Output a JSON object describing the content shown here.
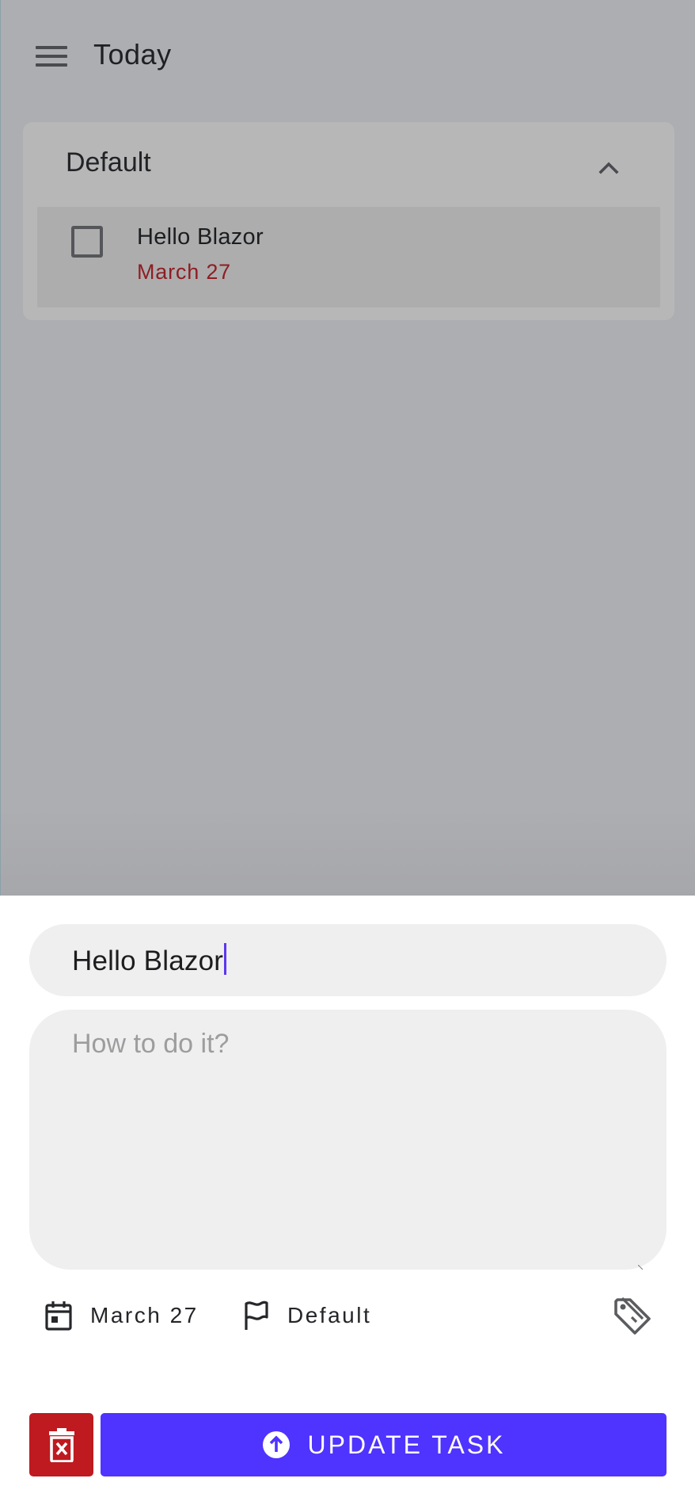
{
  "appbar": {
    "title": "Today",
    "menu_icon": "hamburger-menu-icon"
  },
  "task_group": {
    "title": "Default",
    "toggle_icon": "chevron-up-icon",
    "tasks": [
      {
        "title": "Hello Blazor",
        "due": "March 27",
        "due_color": "#8f1d24",
        "completed": false
      }
    ]
  },
  "editor": {
    "title_value": "Hello Blazor",
    "notes_placeholder": "How to do it?",
    "notes_value": "",
    "due_date": "March 27",
    "due_icon": "calendar-icon",
    "list_name": "Default",
    "list_icon": "flag-icon",
    "tag_icon": "tag-icon",
    "delete_icon": "trash-x-icon",
    "update_label": "UPDATE TASK",
    "update_icon": "arrow-up-circle-icon"
  },
  "colors": {
    "accent": "#4f33ff",
    "danger": "#be1a1f",
    "overdue": "#8f1d24",
    "scrim": "#adaeb2"
  }
}
